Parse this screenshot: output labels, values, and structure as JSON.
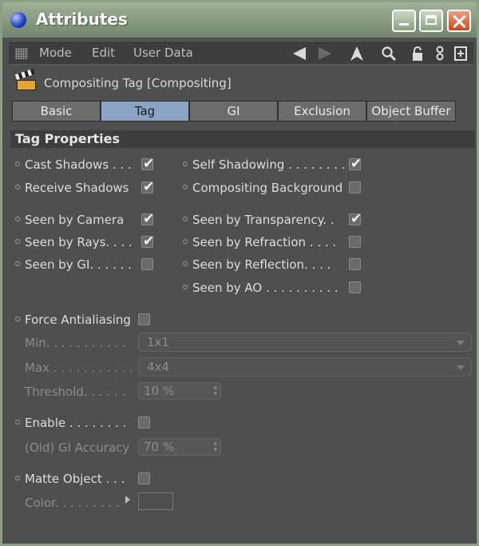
{
  "window": {
    "title": "Attributes"
  },
  "menu": {
    "items": [
      "Mode",
      "Edit",
      "User Data"
    ]
  },
  "header": {
    "title": "Compositing Tag [Compositing]"
  },
  "tabs": [
    "Basic",
    "Tag",
    "GI",
    "Exclusion",
    "Object Buffer"
  ],
  "active_tab": "Tag",
  "section": {
    "title": "Tag Properties"
  },
  "props": {
    "cast_shadows": "Cast Shadows . . .",
    "receive_shadows": "Receive Shadows",
    "self_shadowing": "Self Shadowing . . . . . . . .",
    "compositing_background": "Compositing Background",
    "seen_by_camera": "Seen by Camera",
    "seen_by_rays": "Seen by Rays. . . .",
    "seen_by_gi": "Seen by GI. . . . . .",
    "seen_by_transparency": "Seen by Transparency. .",
    "seen_by_refraction": "Seen by Refraction . . . .",
    "seen_by_reflection": "Seen by Reflection. . . .",
    "seen_by_ao": "Seen by AO . . . . . . . . . .",
    "force_antialiasing": "Force Antialiasing",
    "min": "Min. . . . . . . . . . .",
    "max": "Max . . . . . . . . . . .",
    "threshold": "Threshold. . . . . .",
    "enable": "Enable . . . . . . . .",
    "old_gi_accuracy": "(Old) GI Accuracy",
    "matte_object": "Matte Object . . .",
    "color": "Color. . . . . . . . ."
  },
  "values": {
    "min": "1x1",
    "max": "4x4",
    "threshold": "10 %",
    "old_gi_accuracy": "70 %"
  },
  "checks": {
    "cast_shadows": true,
    "receive_shadows": true,
    "self_shadowing": true,
    "compositing_background": false,
    "seen_by_camera": true,
    "seen_by_rays": true,
    "seen_by_gi": false,
    "seen_by_transparency": true,
    "seen_by_refraction": false,
    "seen_by_reflection": false,
    "seen_by_ao": false,
    "force_antialiasing": false,
    "enable": false,
    "matte_object": false
  },
  "icons": [
    "back-arrow-icon",
    "forward-arrow-icon",
    "up-arrow-icon",
    "search-icon",
    "lock-icon",
    "link-icon",
    "new-panel-icon"
  ]
}
